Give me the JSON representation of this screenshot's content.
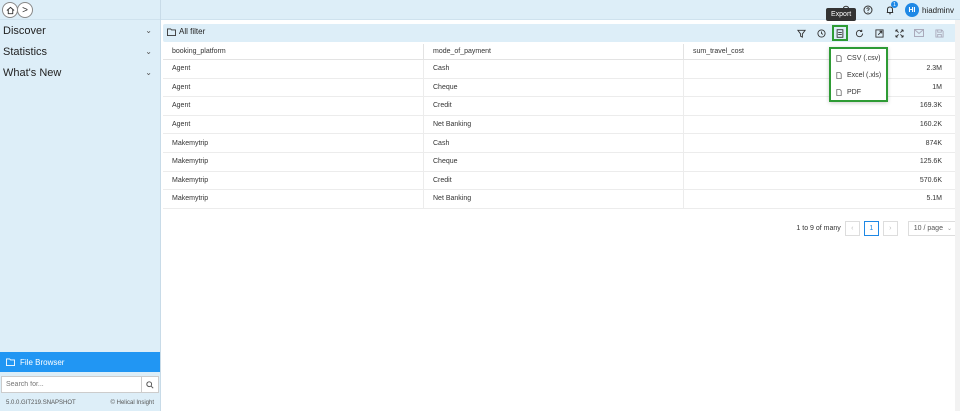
{
  "nav": {
    "items": [
      {
        "label": "Discover"
      },
      {
        "label": "Statistics"
      },
      {
        "label": "What's New"
      }
    ],
    "file_browser": "File Browser",
    "search_placeholder": "Search for...",
    "version": "5.0.0.GIT219.SNAPSHOT",
    "brand": "Helical Insight"
  },
  "topbar": {
    "notification_count": "1",
    "avatar_initials": "HI",
    "username": "hiadmin"
  },
  "toolbar": {
    "title": "All filter",
    "tooltip": "Export"
  },
  "export_menu": {
    "items": [
      {
        "label": "CSV (.csv)"
      },
      {
        "label": "Excel (.xls)"
      },
      {
        "label": "PDF"
      }
    ]
  },
  "table": {
    "columns": [
      "booking_platform",
      "mode_of_payment",
      "sum_travel_cost"
    ],
    "rows": [
      [
        "Agent",
        "Cash",
        "2.3M"
      ],
      [
        "Agent",
        "Cheque",
        "1M"
      ],
      [
        "Agent",
        "Credit",
        "169.3K"
      ],
      [
        "Agent",
        "Net Banking",
        "160.2K"
      ],
      [
        "Makemytrip",
        "Cash",
        "874K"
      ],
      [
        "Makemytrip",
        "Cheque",
        "125.6K"
      ],
      [
        "Makemytrip",
        "Credit",
        "570.6K"
      ],
      [
        "Makemytrip",
        "Net Banking",
        "5.1M"
      ]
    ]
  },
  "pagination": {
    "summary": "1 to 9 of many",
    "current_page": "1",
    "page_size": "10 / page"
  },
  "colors": {
    "accent": "#2196f3",
    "highlight": "#2e9b35",
    "panel": "#ddeef8"
  }
}
